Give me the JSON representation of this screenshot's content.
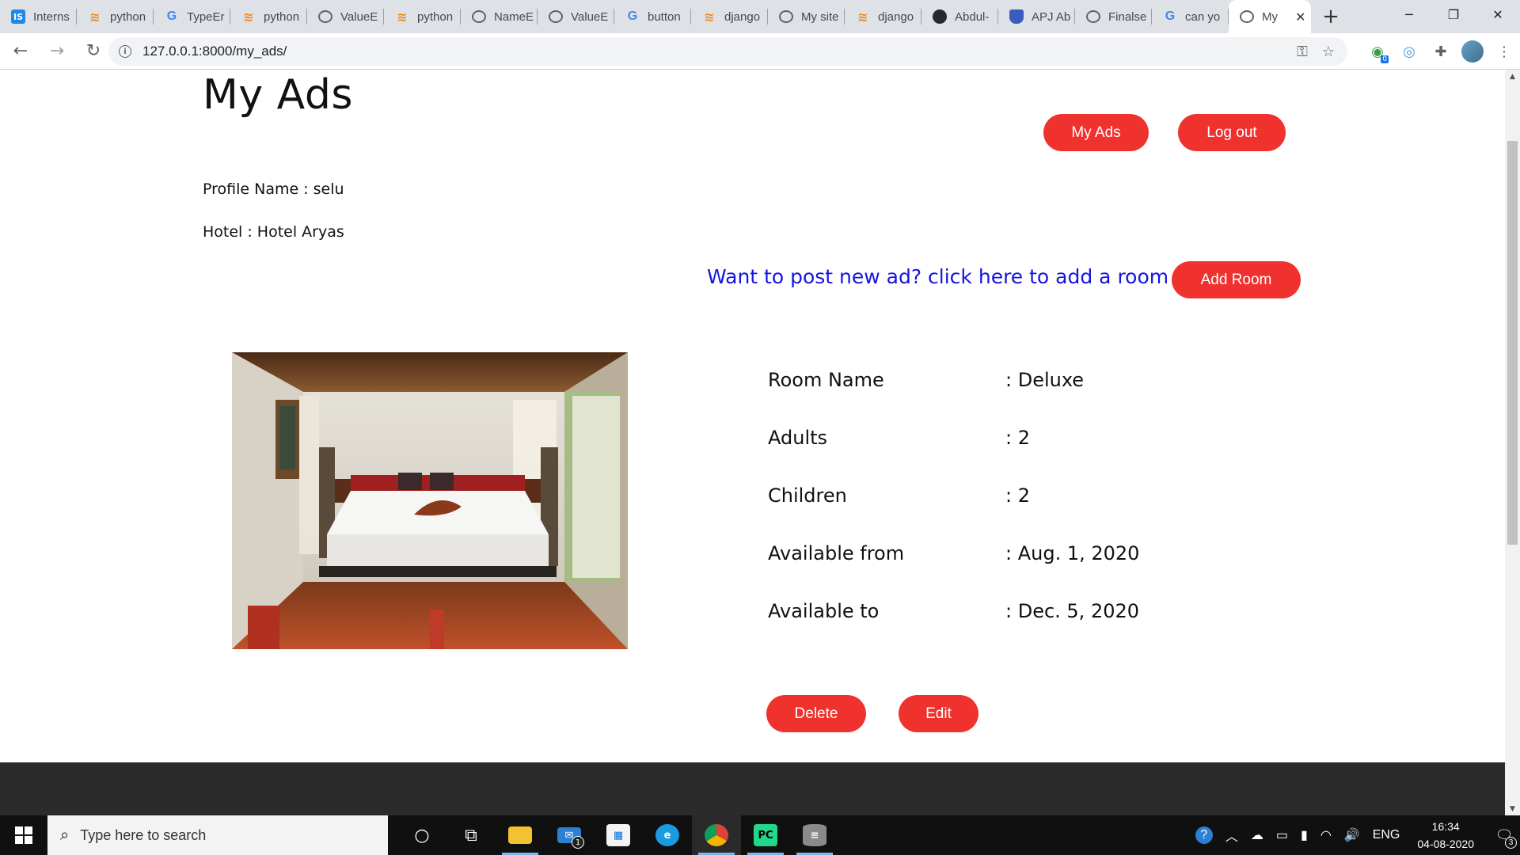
{
  "browser": {
    "tabs": [
      {
        "title": "Interns",
        "icon": "is-icon"
      },
      {
        "title": "python",
        "icon": "stackoverflow-icon"
      },
      {
        "title": "TypeEr",
        "icon": "google-icon"
      },
      {
        "title": "python",
        "icon": "stackoverflow-icon"
      },
      {
        "title": "ValueE",
        "icon": "globe-icon"
      },
      {
        "title": "python",
        "icon": "stackoverflow-icon"
      },
      {
        "title": "NameE",
        "icon": "globe-icon"
      },
      {
        "title": "ValueE",
        "icon": "globe-icon"
      },
      {
        "title": "button",
        "icon": "google-icon"
      },
      {
        "title": "django",
        "icon": "stackoverflow-icon"
      },
      {
        "title": "My site",
        "icon": "globe-icon"
      },
      {
        "title": "django",
        "icon": "stackoverflow-icon"
      },
      {
        "title": "Abdul-",
        "icon": "github-icon"
      },
      {
        "title": "APJ Ab",
        "icon": "shield-icon"
      },
      {
        "title": "Finalse",
        "icon": "globe-icon"
      },
      {
        "title": "can yo",
        "icon": "google-icon"
      }
    ],
    "active_tab": {
      "title": "My",
      "icon": "globe-icon"
    },
    "url": "127.0.0.1:8000/my_ads/",
    "extension_badge": "0"
  },
  "page": {
    "title": "My Ads",
    "nav": {
      "my_ads": "My Ads",
      "logout": "Log out"
    },
    "profile_line": "Profile Name : selu",
    "hotel_line": "Hotel : Hotel Aryas",
    "post_link": "Want to post new ad? click here to add a room",
    "add_room": "Add Room",
    "room": {
      "fields": [
        {
          "label": "Room Name",
          "value": ": Deluxe"
        },
        {
          "label": "Adults",
          "value": ": 2"
        },
        {
          "label": "Children",
          "value": ": 2"
        },
        {
          "label": "Available from",
          "value": ": Aug. 1, 2020"
        },
        {
          "label": "Available to",
          "value": ": Dec. 5, 2020"
        }
      ],
      "delete": "Delete",
      "edit": "Edit"
    }
  },
  "taskbar": {
    "search_placeholder": "Type here to search",
    "mail_badge": "1",
    "language": "ENG",
    "time": "16:34",
    "date": "04-08-2020",
    "notifications": "3"
  },
  "colors": {
    "accent_button": "#f0322f",
    "link": "#1515e0",
    "footer": "#2b2b2b"
  }
}
